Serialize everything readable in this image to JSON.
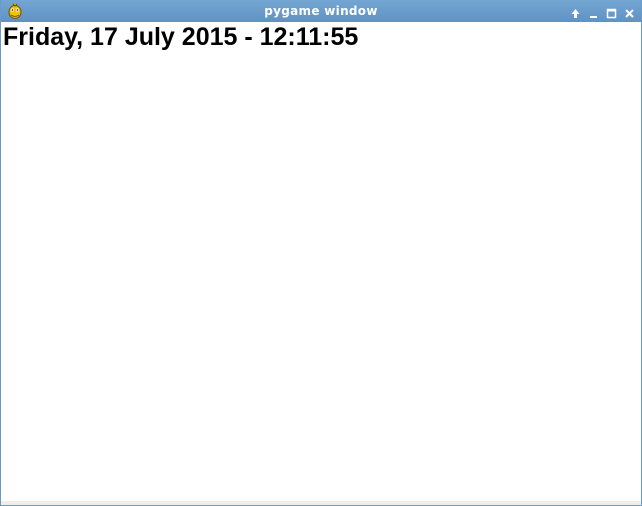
{
  "window": {
    "title": "pygame window",
    "app_icon": "pygame-snake-icon",
    "controls": [
      "shade-up-icon",
      "minimize-icon",
      "maximize-icon",
      "close-icon"
    ],
    "titlebar_color": "#6a9ac9",
    "background_color": "#ffffff"
  },
  "content": {
    "clock_text": "Friday, 17 July 2015 - 12:11:55",
    "text_color": "#000000"
  }
}
